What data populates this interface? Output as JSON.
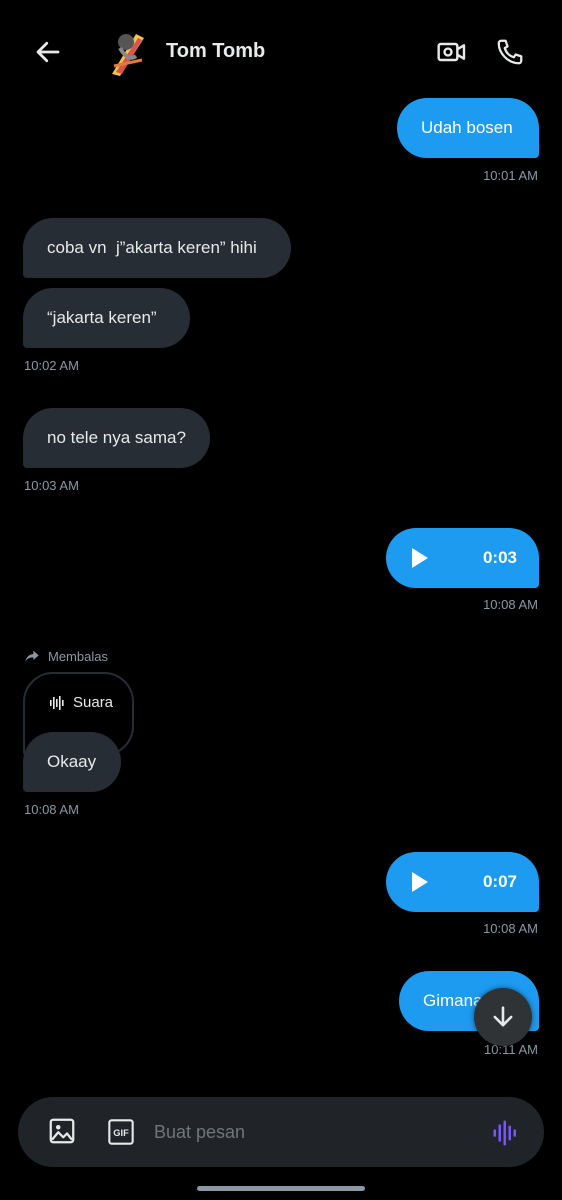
{
  "header": {
    "contact_name": "Tom Tomb"
  },
  "messages": [
    {
      "direction": "out",
      "text": "Udah bosen",
      "time": "10:01 AM"
    },
    {
      "direction": "in",
      "text": "coba vn  j”akarta keren” hihi"
    },
    {
      "direction": "in",
      "text": "“jakarta keren”",
      "time": "10:02 AM"
    },
    {
      "direction": "in",
      "text": "no tele nya sama?",
      "time": "10:03 AM"
    },
    {
      "direction": "out",
      "type": "audio",
      "duration": "0:03",
      "time": "10:08 AM"
    },
    {
      "direction": "in",
      "reply_label": "Membalas",
      "quoted": "Suara",
      "text": "Okaay",
      "time": "10:08 AM"
    },
    {
      "direction": "out",
      "type": "audio",
      "duration": "0:07",
      "time": "10:08 AM"
    },
    {
      "direction": "out",
      "text": "Gimana",
      "time": "10:11 AM"
    }
  ],
  "composer": {
    "placeholder": "Buat pesan",
    "gif_label": "GIF"
  },
  "colors": {
    "outgoing_bubble": "#1d9bf0",
    "incoming_bubble": "#262d34",
    "voice_accent": "#7856ff"
  }
}
